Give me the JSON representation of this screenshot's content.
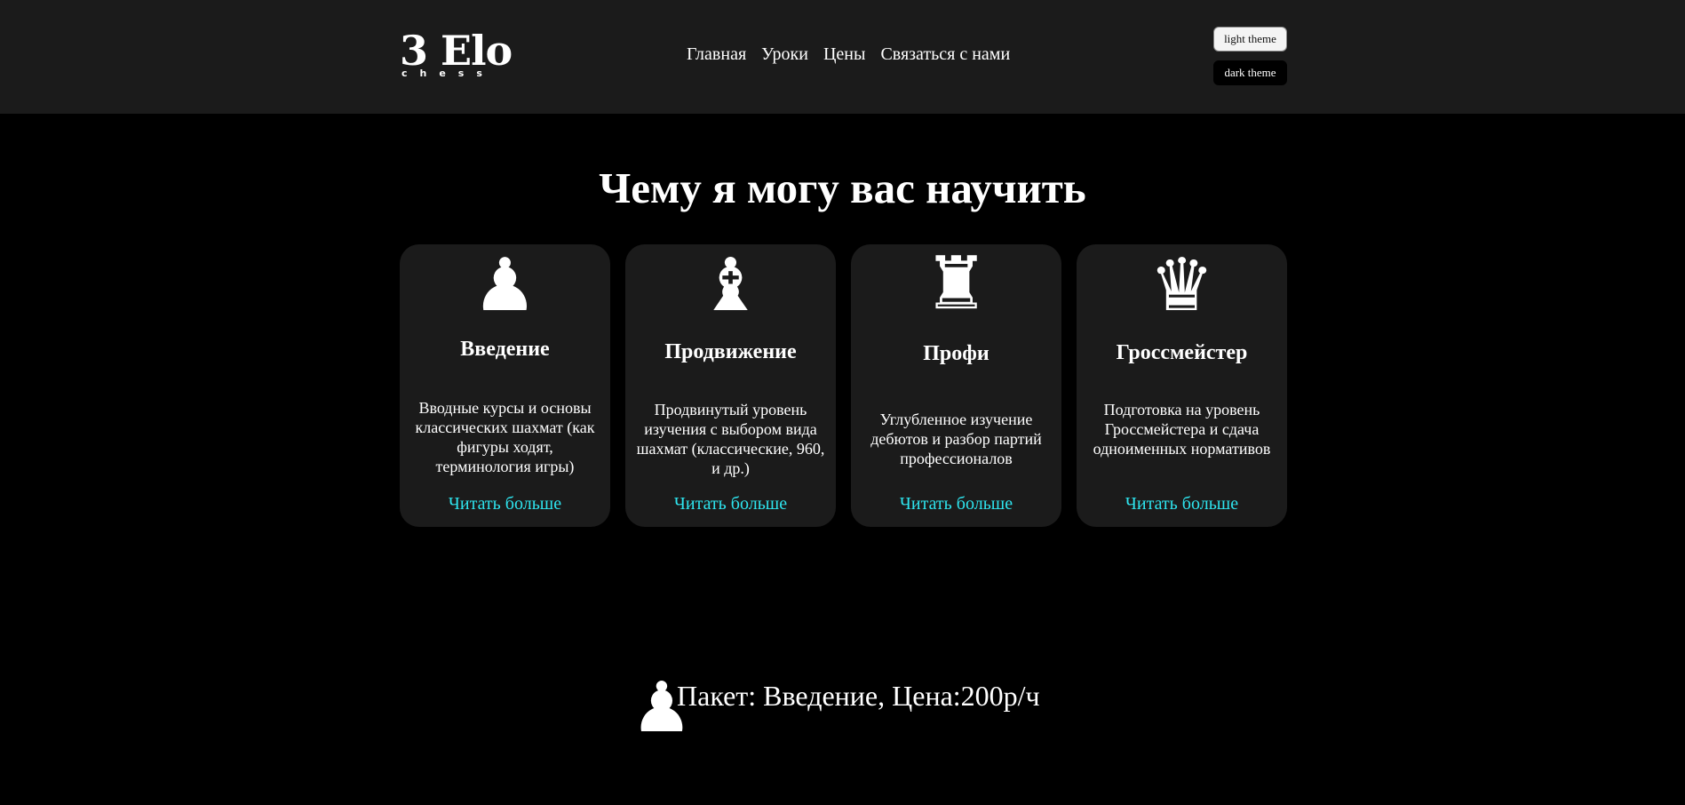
{
  "header": {
    "logo_main": "3 Elo",
    "logo_sub": "chess",
    "nav": [
      "Главная",
      "Уроки",
      "Цены",
      "Связаться с нами"
    ],
    "light_theme_label": "light theme",
    "dark_theme_label": "dark theme"
  },
  "section": {
    "title": "Чему я могу вас научить"
  },
  "cards": [
    {
      "icon": "pawn-icon",
      "glyph": "♟",
      "title": "Введение",
      "description": "Вводные курсы и основы классических шахмат (как фигуры ходят, терминология игры)",
      "link": "Читать больше"
    },
    {
      "icon": "bishop-icon",
      "glyph": "♝",
      "title": "Продвижение",
      "description": "Продвинутый уровень изучения с выбором вида шахмат (классические, 960, и др.)",
      "link": "Читать больше"
    },
    {
      "icon": "rook-icon",
      "glyph": "♜",
      "title": "Профи",
      "description": "Углубленное изучение дебютов и разбор партий профессионалов",
      "link": "Читать больше"
    },
    {
      "icon": "queen-icon",
      "glyph": "♛",
      "title": "Гроссмейстер",
      "description": "Подготовка на уровень Гроссмейстера и сдача одноименных нормативов",
      "link": "Читать больше"
    }
  ],
  "package": {
    "icon": "pawn-icon",
    "glyph": "♟",
    "text": "Пакет: Введение, Цена:200р/ч"
  },
  "colors": {
    "background": "#000000",
    "header_bg": "#1b1b1b",
    "card_bg": "#1b1b1b",
    "link": "#2ee4ee"
  }
}
